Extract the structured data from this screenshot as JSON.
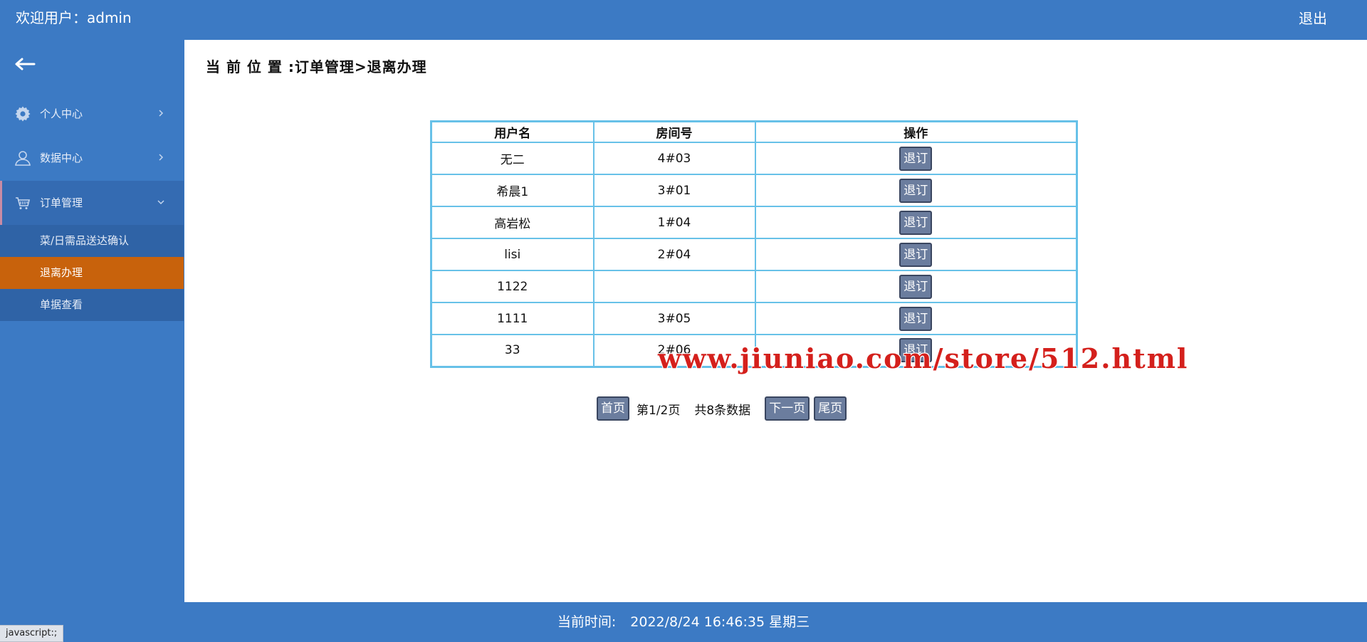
{
  "header": {
    "welcome": "欢迎用户：admin",
    "logout": "退出"
  },
  "sidebar": {
    "back_icon": "arrow-left-icon",
    "items": [
      {
        "label": "个人中心",
        "icon": "gear-icon"
      },
      {
        "label": "数据中心",
        "icon": "user-icon"
      },
      {
        "label": "订单管理",
        "icon": "cart-icon"
      }
    ],
    "subitems": [
      {
        "label": "菜/日需品送达确认"
      },
      {
        "label": "退离办理"
      },
      {
        "label": "单据查看"
      }
    ],
    "active_subitem": "退离办理"
  },
  "main": {
    "breadcrumb": "当 前 位 置 :订单管理>退离办理",
    "table": {
      "headers": [
        "用户名",
        "房间号",
        "操作"
      ],
      "rows": [
        {
          "username": "无二",
          "room": "4#03",
          "action": "退订"
        },
        {
          "username": "希晨1",
          "room": "3#01",
          "action": "退订"
        },
        {
          "username": "高岩松",
          "room": "1#04",
          "action": "退订"
        },
        {
          "username": "lisi",
          "room": "2#04",
          "action": "退订"
        },
        {
          "username": "1122",
          "room": "",
          "action": "退订"
        },
        {
          "username": "1111",
          "room": "3#05",
          "action": "退订"
        },
        {
          "username": "33",
          "room": "2#06",
          "action": "退订"
        }
      ]
    },
    "pager": {
      "first": "首页",
      "page_info": "第1/2页",
      "total": "共8条数据",
      "next": "下一页",
      "last": "尾页"
    },
    "watermark": "www.jiuniao.com/store/512.html"
  },
  "footer": {
    "label": "当前时间:",
    "datetime": "2022/8/24 16:46:35 星期三"
  },
  "statusbar": "javascript:;",
  "colors": {
    "brand_blue": "#3c7ac4",
    "active_orange": "#c8620c",
    "table_border": "#67c1e8",
    "button_gray": "#6b7d9e"
  }
}
